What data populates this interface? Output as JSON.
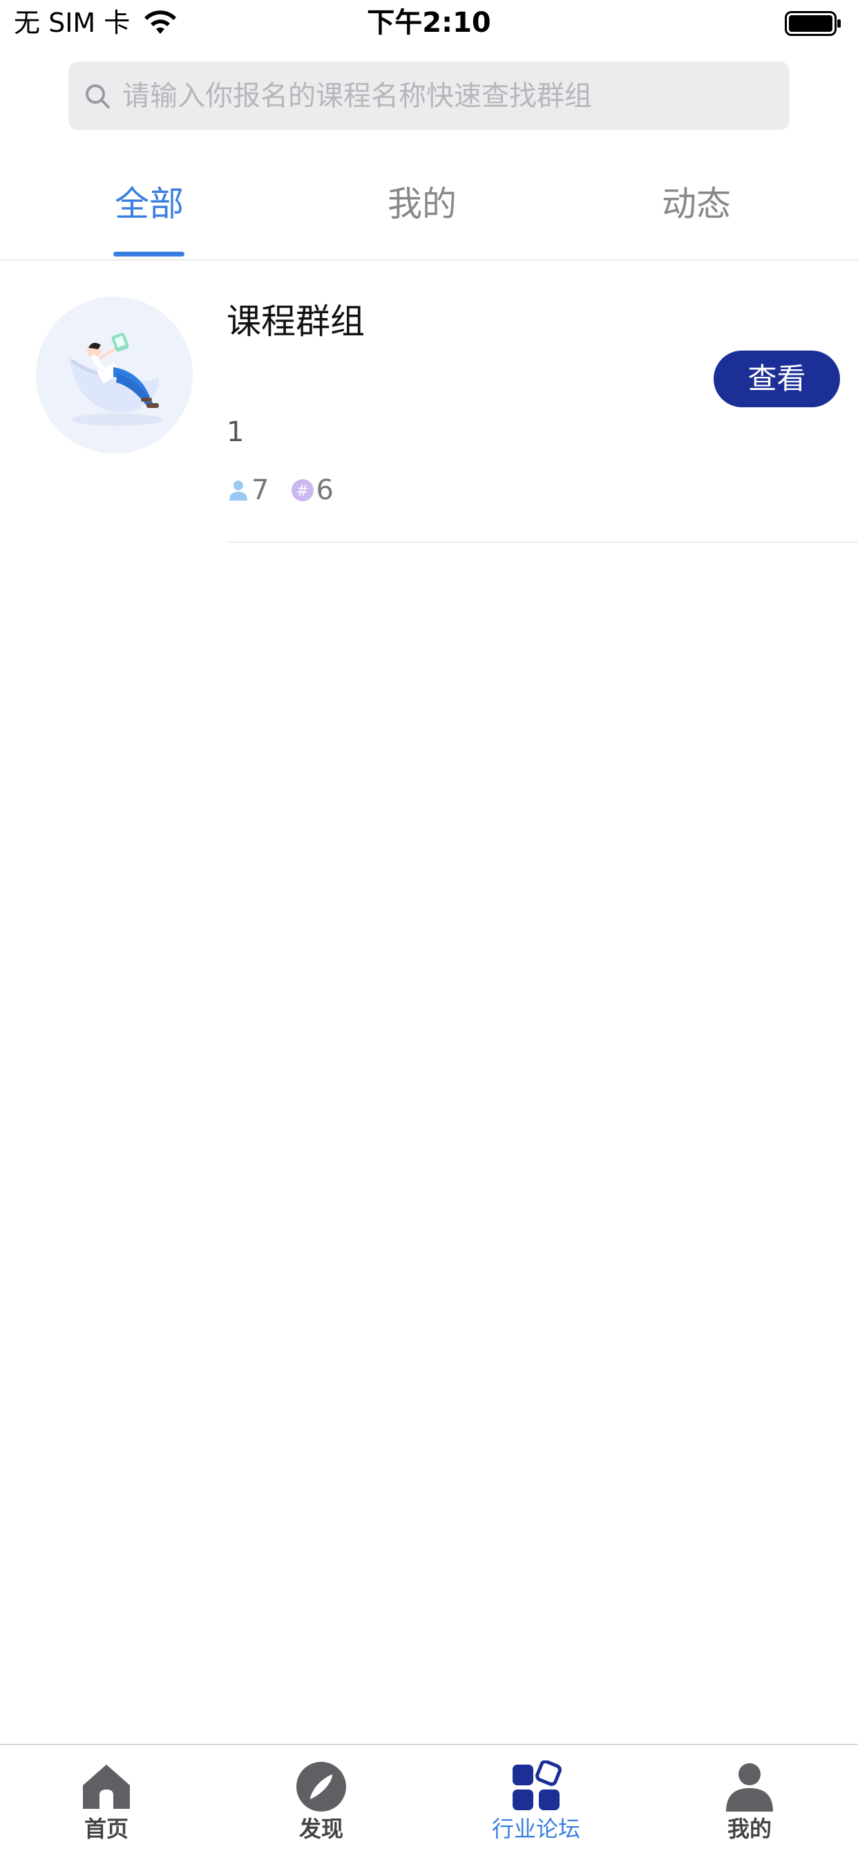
{
  "status_bar": {
    "carrier": "无 SIM 卡",
    "time": "下午2:10"
  },
  "search": {
    "placeholder": "请输入你报名的课程名称快速查找群组",
    "value": ""
  },
  "tabs": [
    {
      "label": "全部",
      "active": true
    },
    {
      "label": "我的",
      "active": false
    },
    {
      "label": "动态",
      "active": false
    }
  ],
  "groups": [
    {
      "title": "课程群组",
      "description": "1",
      "member_count": "7",
      "topic_count": "6",
      "view_label": "查看"
    }
  ],
  "bottom_nav": [
    {
      "label": "首页",
      "icon": "home-icon",
      "active": false
    },
    {
      "label": "发现",
      "icon": "compass-icon",
      "active": false
    },
    {
      "label": "行业论坛",
      "icon": "forum-grid-icon",
      "active": true
    },
    {
      "label": "我的",
      "icon": "person-icon",
      "active": false
    }
  ],
  "colors": {
    "accent": "#3a7fe0",
    "button": "#1c2f96",
    "search_bg": "#ececee"
  }
}
